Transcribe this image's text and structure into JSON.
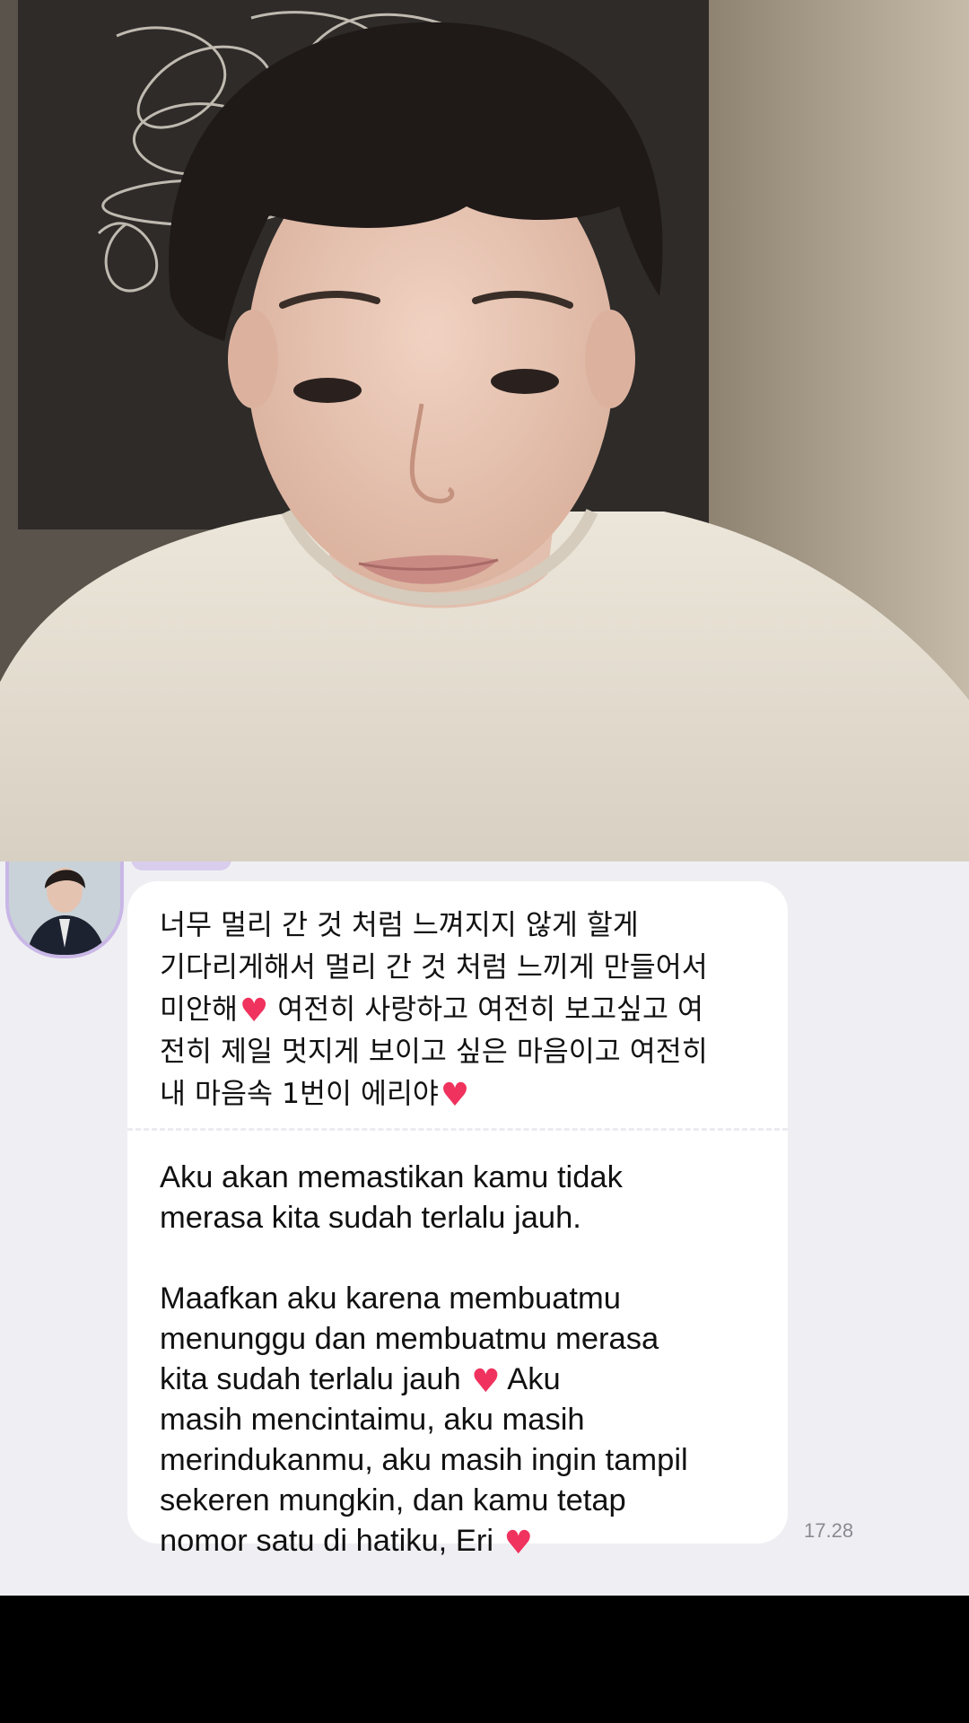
{
  "video": {
    "description_icon": "live-video-frame"
  },
  "chat": {
    "sender_name": "",
    "avatar_icon": "profile-avatar",
    "message": {
      "korean_lines": [
        "너무 멀리 간 것 처럼 느껴지지 않게 할게",
        "기다리게해서 멀리 간 것 처럼 느끼게 만들어서",
        "미안해",
        " 여전히 사랑하고 여전히 보고싶고 여",
        "전히 제일 멋지게 보이고 싶은 마음이고 여전히",
        "내 마음속 1번이 에리야"
      ],
      "indonesian_para1": [
        "Aku akan memastikan kamu tidak",
        "merasa kita sudah terlalu jauh."
      ],
      "indonesian_para2": [
        "Maafkan aku karena membuatmu",
        "menunggu dan membuatmu merasa",
        "kita sudah terlalu jauh ",
        " Aku",
        "masih mencintaimu, aku masih",
        "merindukanmu, aku masih ingin tampil",
        "sekeren mungkin, dan kamu tetap",
        "nomor satu di hatiku, Eri "
      ],
      "heart_glyph": "♥"
    },
    "timestamp": "17.28"
  },
  "colors": {
    "chat_background": "#efeff3",
    "bubble": "#ffffff",
    "heart": "#f0325e",
    "avatar_ring": "#c8b7e6"
  }
}
